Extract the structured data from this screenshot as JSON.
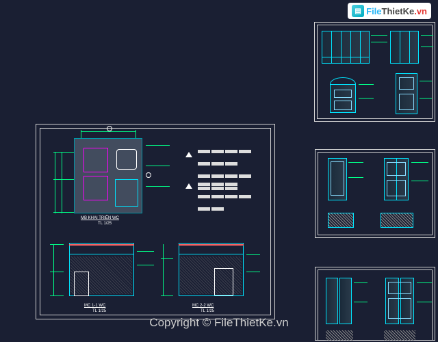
{
  "watermark": {
    "file": "File",
    "thietke": "ThietKe",
    "vn": ".vn"
  },
  "copyright": "Copyright © FileThietKe.vn",
  "main_sheet": {
    "plan_title": "MB KHAI TRIỂN WC",
    "plan_scale": "TL 1/25",
    "sec1_title": "MC 1-1 WC",
    "sec1_scale": "TL 1/25",
    "sec2_title": "MC 2-2 WC",
    "sec2_scale": "TL 1/25"
  },
  "sheet_r1": {},
  "sheet_r2": {},
  "sheet_r3": {}
}
